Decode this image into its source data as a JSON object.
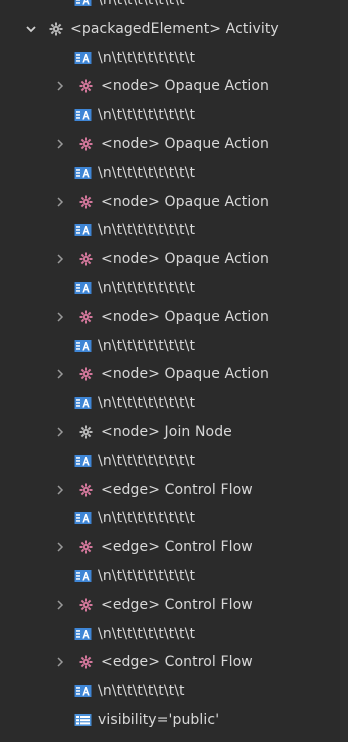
{
  "tree": {
    "rows": [
      {
        "label": "\\n\\t\\t\\t\\t\\t\\t\\t",
        "icon": "text-node-icon",
        "level": 1,
        "twisty": "none"
      },
      {
        "label": "<packagedElement> Activity",
        "icon": "element-gear-icon-gray",
        "level": 0,
        "twisty": "expanded"
      },
      {
        "label": "\\n\\t\\t\\t\\t\\t\\t\\t\\t",
        "icon": "text-node-icon",
        "level": 1,
        "twisty": "none"
      },
      {
        "label": "<node> Opaque Action",
        "icon": "element-gear-icon-pink",
        "level": 1,
        "twisty": "collapsed"
      },
      {
        "label": "\\n\\t\\t\\t\\t\\t\\t\\t\\t",
        "icon": "text-node-icon",
        "level": 1,
        "twisty": "none"
      },
      {
        "label": "<node> Opaque Action",
        "icon": "element-gear-icon-pink",
        "level": 1,
        "twisty": "collapsed"
      },
      {
        "label": "\\n\\t\\t\\t\\t\\t\\t\\t\\t",
        "icon": "text-node-icon",
        "level": 1,
        "twisty": "none"
      },
      {
        "label": "<node> Opaque Action",
        "icon": "element-gear-icon-pink",
        "level": 1,
        "twisty": "collapsed"
      },
      {
        "label": "\\n\\t\\t\\t\\t\\t\\t\\t\\t",
        "icon": "text-node-icon",
        "level": 1,
        "twisty": "none"
      },
      {
        "label": "<node> Opaque Action",
        "icon": "element-gear-icon-pink",
        "level": 1,
        "twisty": "collapsed"
      },
      {
        "label": "\\n\\t\\t\\t\\t\\t\\t\\t\\t",
        "icon": "text-node-icon",
        "level": 1,
        "twisty": "none"
      },
      {
        "label": "<node> Opaque Action",
        "icon": "element-gear-icon-pink",
        "level": 1,
        "twisty": "collapsed"
      },
      {
        "label": "\\n\\t\\t\\t\\t\\t\\t\\t\\t",
        "icon": "text-node-icon",
        "level": 1,
        "twisty": "none"
      },
      {
        "label": "<node> Opaque Action",
        "icon": "element-gear-icon-pink",
        "level": 1,
        "twisty": "collapsed"
      },
      {
        "label": "\\n\\t\\t\\t\\t\\t\\t\\t\\t",
        "icon": "text-node-icon",
        "level": 1,
        "twisty": "none"
      },
      {
        "label": "<node> Join Node",
        "icon": "element-gear-icon-gray",
        "level": 1,
        "twisty": "collapsed"
      },
      {
        "label": "\\n\\t\\t\\t\\t\\t\\t\\t\\t",
        "icon": "text-node-icon",
        "level": 1,
        "twisty": "none"
      },
      {
        "label": "<edge> Control Flow",
        "icon": "element-gear-icon-pink",
        "level": 1,
        "twisty": "collapsed"
      },
      {
        "label": "\\n\\t\\t\\t\\t\\t\\t\\t\\t",
        "icon": "text-node-icon",
        "level": 1,
        "twisty": "none"
      },
      {
        "label": "<edge> Control Flow",
        "icon": "element-gear-icon-pink",
        "level": 1,
        "twisty": "collapsed"
      },
      {
        "label": "\\n\\t\\t\\t\\t\\t\\t\\t\\t",
        "icon": "text-node-icon",
        "level": 1,
        "twisty": "none"
      },
      {
        "label": "<edge> Control Flow",
        "icon": "element-gear-icon-pink",
        "level": 1,
        "twisty": "collapsed"
      },
      {
        "label": "\\n\\t\\t\\t\\t\\t\\t\\t\\t",
        "icon": "text-node-icon",
        "level": 1,
        "twisty": "none"
      },
      {
        "label": "<edge> Control Flow",
        "icon": "element-gear-icon-pink",
        "level": 1,
        "twisty": "collapsed"
      },
      {
        "label": "\\n\\t\\t\\t\\t\\t\\t\\t",
        "icon": "text-node-icon",
        "level": 1,
        "twisty": "none"
      },
      {
        "label": "visibility='public'",
        "icon": "attribute-icon",
        "level": 1,
        "twisty": "none"
      }
    ]
  },
  "colors": {
    "background": "#2b2b2b",
    "text": "#d8d8d8",
    "gear_pink": "#d4789c",
    "gear_gray": "#b9b9b9",
    "text_icon_blue": "#3f86d6",
    "attribute_icon_blue": "#4a90d9"
  }
}
